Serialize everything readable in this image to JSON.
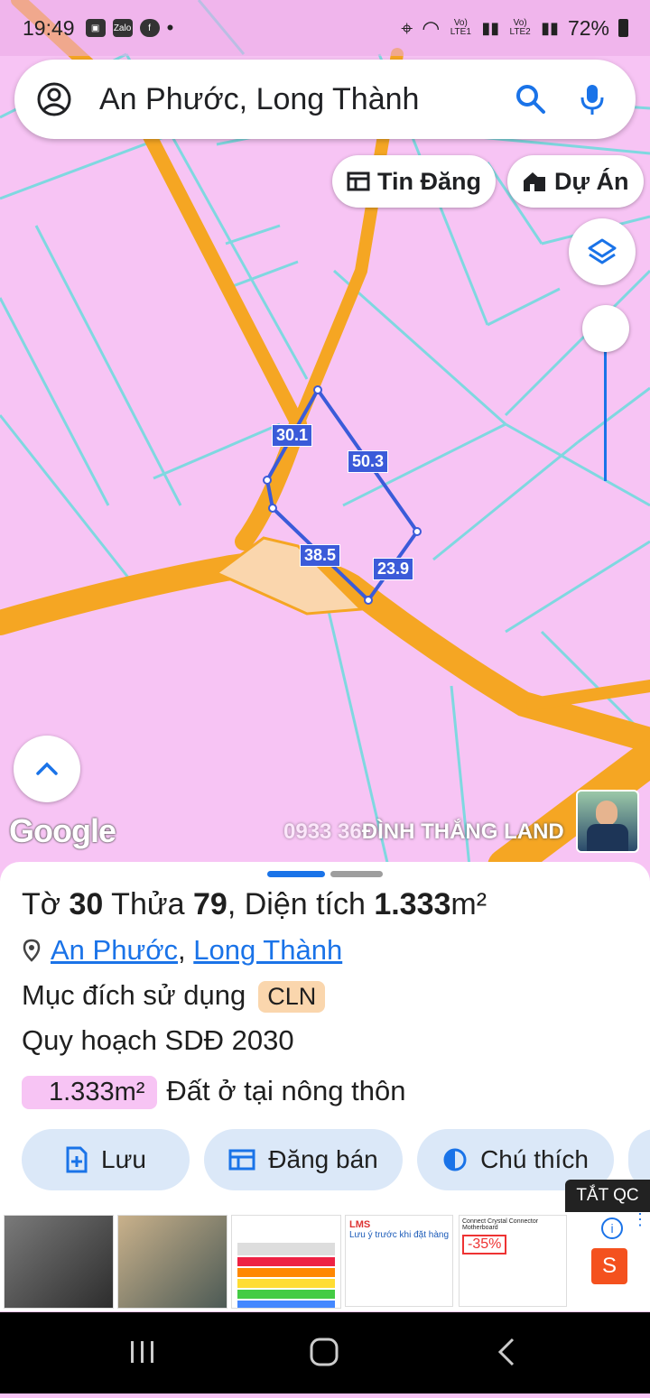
{
  "status_bar": {
    "time": "19:49",
    "battery": "72%",
    "sim1_label": "Vo) LTE1",
    "sim2_label": "Vo) LTE2",
    "app_icons": [
      "gallery-icon",
      "zalo-icon",
      "facebook-icon"
    ],
    "zalo_label": "Zalo"
  },
  "search": {
    "text": "An Phước, Long Thành"
  },
  "chips": {
    "tin_dang": "Tin Đăng",
    "du_an": "Dự Án"
  },
  "map": {
    "edge_labels": [
      "30.1",
      "50.3",
      "38.5",
      "23.9"
    ],
    "google_logo": "Google",
    "watermark_phone": "0933 36",
    "watermark_name": "ĐÌNH THẮNG LAND",
    "colors": {
      "land": "#f7c4f4",
      "road": "#f5a623",
      "parcel_line": "#7fd8e0",
      "selection": "#3b5bd9"
    }
  },
  "sheet": {
    "title_prefix_1": "Tờ ",
    "sheet_no": "30",
    "title_prefix_2": " Thửa ",
    "parcel_no": "79",
    "title_prefix_3": ", Diện tích ",
    "area": "1.333",
    "area_unit": "m²",
    "location_ward": "An Phước",
    "location_sep": ",",
    "location_district": "Long Thành",
    "usage_label": "Mục đích sử dụng",
    "usage_code": "CLN",
    "plan_label": "Quy hoạch SDĐ 2030",
    "plan_area": "1.333m²",
    "plan_type": "Đất ở tại nông thôn",
    "buttons": {
      "save": "Lưu",
      "sell": "Đăng bán",
      "legend": "Chú thích"
    }
  },
  "ads": {
    "close_label": "TẮT QC",
    "discount": "-35%",
    "ad4_title": "Lưu ý trước khi đặt hàng",
    "ad4_brand": "LMS",
    "ad5_title": "Connect Crystal Connector Motherboard",
    "shop_letter": "S"
  }
}
